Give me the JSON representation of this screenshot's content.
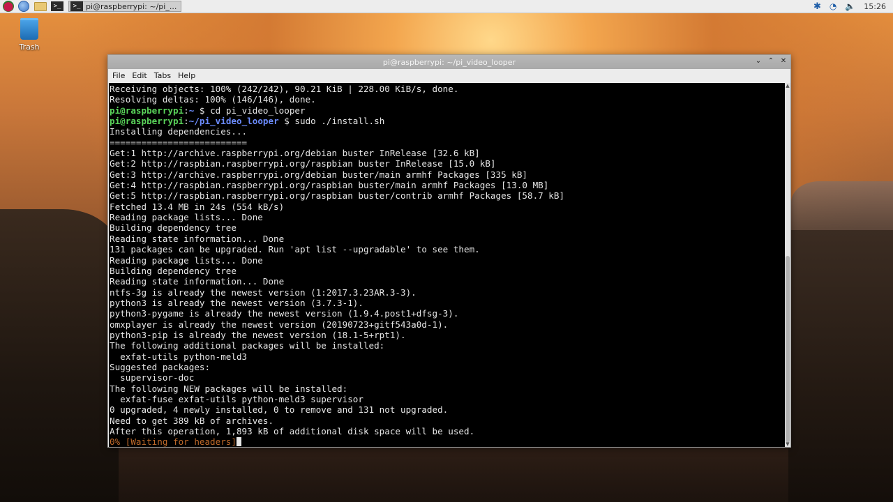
{
  "taskbar": {
    "task_title": "pi@raspberrypi: ~/pi_...",
    "clock": "15:26",
    "icons": [
      "raspberry-pi-menu-icon",
      "web-browser-icon",
      "file-manager-icon",
      "terminal-icon",
      "bluetooth-icon",
      "wifi-icon",
      "volume-icon"
    ]
  },
  "desktop": {
    "trash_label": "Trash"
  },
  "window": {
    "title": "pi@raspberrypi: ~/pi_video_looper",
    "menu": [
      "File",
      "Edit",
      "Tabs",
      "Help"
    ]
  },
  "terminal": {
    "colors": {
      "user": "#5ad35a",
      "dir": "#6c8cff",
      "progress": "#c06a2a",
      "text": "#e6e6e6"
    },
    "lines": [
      "Receiving objects: 100% (242/242), 90.21 KiB | 228.00 KiB/s, done.",
      "Resolving deltas: 100% (146/146), done.",
      {
        "user": "pi@raspberrypi",
        "sep": ":",
        "dir": "~",
        "prompt": " $ ",
        "cmd": "cd pi_video_looper"
      },
      {
        "user": "pi@raspberrypi",
        "sep": ":",
        "dir": "~/pi_video_looper",
        "prompt": " $ ",
        "cmd": "sudo ./install.sh"
      },
      "Installing dependencies...",
      "==========================",
      "Get:1 http://archive.raspberrypi.org/debian buster InRelease [32.6 kB]",
      "Get:2 http://raspbian.raspberrypi.org/raspbian buster InRelease [15.0 kB]",
      "Get:3 http://archive.raspberrypi.org/debian buster/main armhf Packages [335 kB]",
      "Get:4 http://raspbian.raspberrypi.org/raspbian buster/main armhf Packages [13.0 MB]",
      "Get:5 http://raspbian.raspberrypi.org/raspbian buster/contrib armhf Packages [58.7 kB]",
      "Fetched 13.4 MB in 24s (554 kB/s)",
      "Reading package lists... Done",
      "Building dependency tree",
      "Reading state information... Done",
      "131 packages can be upgraded. Run 'apt list --upgradable' to see them.",
      "Reading package lists... Done",
      "Building dependency tree",
      "Reading state information... Done",
      "ntfs-3g is already the newest version (1:2017.3.23AR.3-3).",
      "python3 is already the newest version (3.7.3-1).",
      "python3-pygame is already the newest version (1.9.4.post1+dfsg-3).",
      "omxplayer is already the newest version (20190723+gitf543a0d-1).",
      "python3-pip is already the newest version (18.1-5+rpt1).",
      "The following additional packages will be installed:",
      "  exfat-utils python-meld3",
      "Suggested packages:",
      "  supervisor-doc",
      "The following NEW packages will be installed:",
      "  exfat-fuse exfat-utils python-meld3 supervisor",
      "0 upgraded, 4 newly installed, 0 to remove and 131 not upgraded.",
      "Need to get 389 kB of archives.",
      "After this operation, 1,893 kB of additional disk space will be used.",
      {
        "progress": "0% [Waiting for headers]"
      }
    ]
  }
}
